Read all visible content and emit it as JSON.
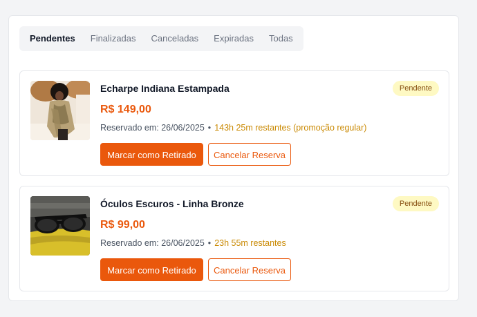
{
  "tabs": [
    {
      "label": "Pendentes",
      "active": true
    },
    {
      "label": "Finalizadas",
      "active": false
    },
    {
      "label": "Canceladas",
      "active": false
    },
    {
      "label": "Expiradas",
      "active": false
    },
    {
      "label": "Todas",
      "active": false
    }
  ],
  "reservations": [
    {
      "title": "Echarpe Indiana Estampada",
      "price": "R$ 149,00",
      "reserved_label": "Reservado em: 26/06/2025",
      "separator": "•",
      "remaining": "143h 25m restantes (promoção regular)",
      "status": "Pendente",
      "primary_action": "Marcar como Retirado",
      "secondary_action": "Cancelar Reserva",
      "image": "woman-with-scarf-photo"
    },
    {
      "title": "Óculos Escuros - Linha Bronze",
      "price": "R$ 99,00",
      "reserved_label": "Reservado em: 26/06/2025",
      "separator": "•",
      "remaining": "23h 55m restantes",
      "status": "Pendente",
      "primary_action": "Marcar como Retirado",
      "secondary_action": "Cancelar Reserva",
      "image": "sunglasses-photo"
    }
  ],
  "colors": {
    "accent": "#ea580c",
    "status_bg": "#fef9c3",
    "status_text": "#854d0e",
    "remaining_text": "#ca8a04"
  }
}
